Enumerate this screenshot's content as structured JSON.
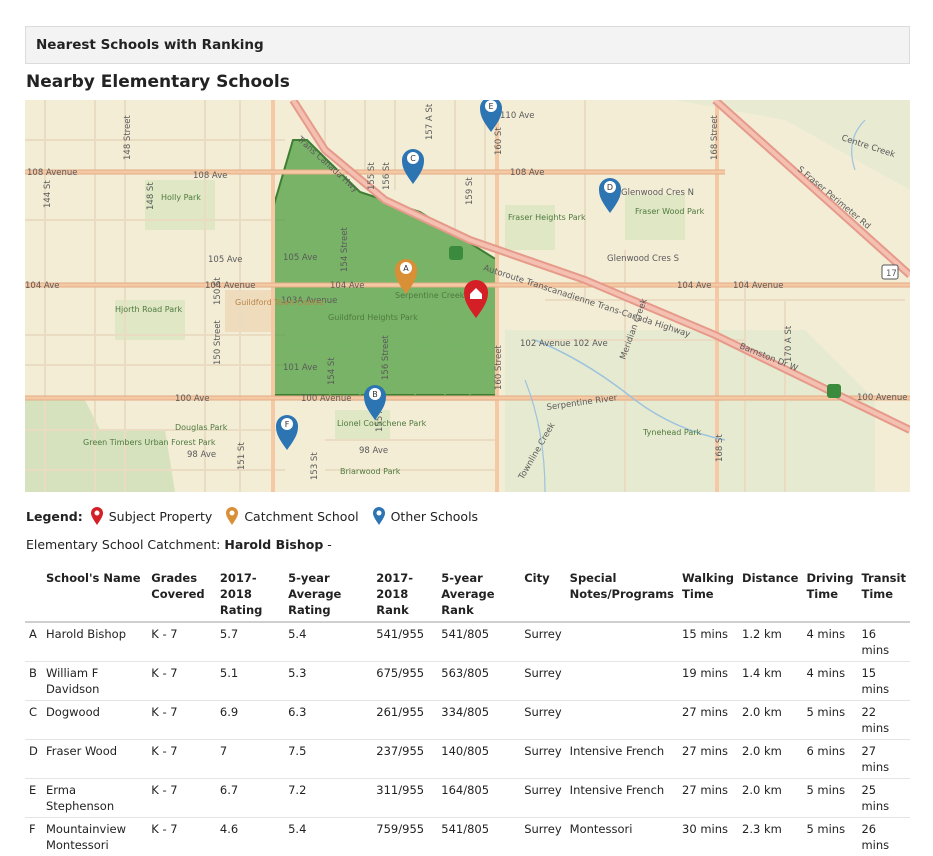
{
  "header": {
    "title": "Nearest Schools with Ranking"
  },
  "page": {
    "title": "Nearby Elementary Schools"
  },
  "map": {
    "street_labels": [
      "108 Avenue",
      "108 Ave",
      "108 Ave",
      "105 Ave",
      "105 Ave",
      "104 Ave",
      "104 Avenue",
      "104 Ave",
      "104 Ave",
      "104 Avenue",
      "103A Avenue",
      "102 Avenue 102 Ave",
      "101 Ave",
      "100 Ave",
      "100 Avenue",
      "100 Avenue",
      "98 Ave",
      "98 Ave",
      "110 Ave",
      "144 St",
      "148 Street",
      "148 St",
      "150 St",
      "150 Street",
      "151 St",
      "153 St",
      "154 St",
      "154 Street",
      "155 A St",
      "155 St",
      "156 St",
      "156 Street",
      "157 A St",
      "159 St",
      "160 St",
      "160 Street",
      "168 Street",
      "168 St",
      "170 A St",
      "Trans Canada Hwy",
      "Autoroute Transcanadienne Trans-Canada Highway",
      "Glenwood Cres N",
      "Glenwood Cres S",
      "S Fraser Perimeter Rd",
      "Barnston Dr W",
      "Serpentine River",
      "Tynehead Park",
      "Green Timbers Urban Forest Park",
      "Holly Park",
      "Hjorth Road Park",
      "Guildford Town Centre",
      "Guildford Heights Park",
      "Fraser Heights Park",
      "Fraser Wood Park",
      "Lionel Courchene Park",
      "Douglas Park",
      "Briarwood Park",
      "Serpentine Creek",
      "Meridian Creek",
      "Townline Creek",
      "Centre Creek",
      "17"
    ],
    "markers": [
      {
        "label": "A",
        "type": "catchment"
      },
      {
        "label": "B",
        "type": "other"
      },
      {
        "label": "C",
        "type": "other"
      },
      {
        "label": "D",
        "type": "other"
      },
      {
        "label": "E",
        "type": "other"
      },
      {
        "label": "F",
        "type": "other"
      }
    ],
    "colors": {
      "subject": "#d51f26",
      "catchment": "#d88f35",
      "other": "#2d74b3",
      "catchment_area": "#4a9d3c"
    }
  },
  "legend": {
    "title": "Legend:",
    "items": [
      {
        "label": "Subject Property",
        "icon": "red-marker-icon"
      },
      {
        "label": "Catchment School",
        "icon": "orange-marker-icon"
      },
      {
        "label": "Other Schools",
        "icon": "blue-marker-icon"
      }
    ]
  },
  "catchment": {
    "label": "Elementary School Catchment:",
    "value": "Harold Bishop",
    "suffix": "-"
  },
  "table": {
    "headers": [
      "",
      "School's Name",
      "Grades\nCovered",
      "2017-2018\nRating",
      "5-year Average\nRating",
      "2017-2018\nRank",
      "5-year Average\nRank",
      "City",
      "Special\nNotes/Programs",
      "Walking\nTime",
      "Distance",
      "Driving\nTime",
      "Transit\nTime"
    ],
    "rows": [
      [
        "A",
        "Harold Bishop",
        "K - 7",
        "5.7",
        "5.4",
        "541/955",
        "541/805",
        "Surrey",
        "",
        "15 mins",
        "1.2 km",
        "4 mins",
        "16 mins"
      ],
      [
        "B",
        "William F Davidson",
        "K - 7",
        "5.1",
        "5.3",
        "675/955",
        "563/805",
        "Surrey",
        "",
        "19 mins",
        "1.4 km",
        "4 mins",
        "15 mins"
      ],
      [
        "C",
        "Dogwood",
        "K - 7",
        "6.9",
        "6.3",
        "261/955",
        "334/805",
        "Surrey",
        "",
        "27 mins",
        "2.0 km",
        "5 mins",
        "22 mins"
      ],
      [
        "D",
        "Fraser Wood",
        "K - 7",
        "7",
        "7.5",
        "237/955",
        "140/805",
        "Surrey",
        "Intensive French",
        "27 mins",
        "2.0 km",
        "6 mins",
        "27 mins"
      ],
      [
        "E",
        "Erma Stephenson",
        "K - 7",
        "6.7",
        "7.2",
        "311/955",
        "164/805",
        "Surrey",
        "Intensive French",
        "27 mins",
        "2.0 km",
        "5 mins",
        "25 mins"
      ],
      [
        "F",
        "Mountainview\nMontessori",
        "K - 7",
        "4.6",
        "5.4",
        "759/955",
        "541/805",
        "Surrey",
        "Montessori",
        "30 mins",
        "2.3 km",
        "5 mins",
        "26 mins"
      ]
    ]
  }
}
